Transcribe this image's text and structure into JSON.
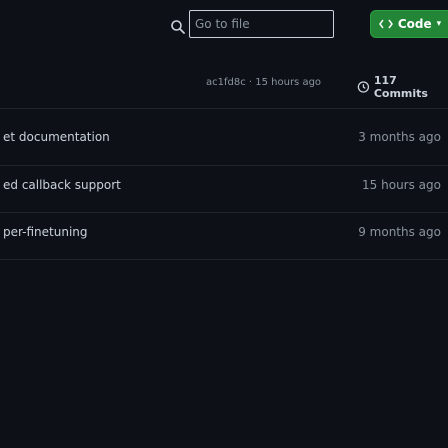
{
  "toolbar": {
    "search_icon": "search-icon",
    "goto_placeholder": "Go to file",
    "code_button_label": "Code",
    "code_icon": "code-icon",
    "caret_icon": "chevron-down-icon",
    "accent_color": "#238636"
  },
  "latest_commit": {
    "hash_and_age": "ac1fd8c · 15 hours ago",
    "commits_label": "117 Commits",
    "history_icon": "history-icon"
  },
  "rows": [
    {
      "message": "et documentation",
      "age": "3 months ago"
    },
    {
      "message": "ed callback support",
      "age": "15 hours ago"
    },
    {
      "message": "per-finetuning",
      "age": "9 months ago"
    }
  ]
}
